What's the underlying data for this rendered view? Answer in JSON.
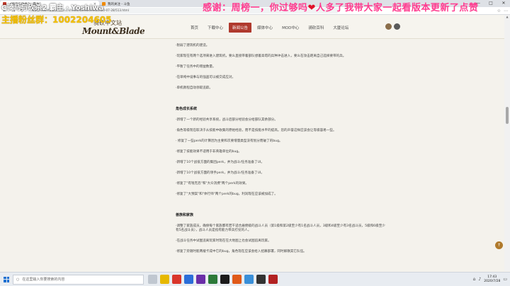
{
  "browser": {
    "tab_active_title": "《骑马与砍杀2：霸主》",
    "tab_inactive_title": "我的关注 - 斗鱼",
    "url": "www.mountblade.com.cn/news/fbnewsfeed/2020-07-28/513.html",
    "window_controls": [
      "—",
      "□",
      "✕"
    ]
  },
  "overlay": {
    "line1": "C骑马与砍杀2 霸主 · Yoshiwa",
    "line2": "主播粉丝群：1002204605",
    "banner": "感谢：周榜一，你过够吗",
    "banner_heart": "❤",
    "banner_tail": "人多了我带大家一起看版本更新了点赞"
  },
  "site": {
    "logo_cn": "骑砍中文站",
    "logo_en": "Mount&Blade",
    "nav": [
      "首页",
      "下载中心",
      "新闻公告",
      "媒体中心",
      "MOD中心",
      "骑砍百科",
      "大厦论坛"
    ],
    "nav_active_index": 2
  },
  "content": {
    "paragraphs_top": [
      "·削弱了建筑机的建造。",
      "·玩家现在有两个选项来进入建筑机，要么直接带着部队想着高塔的兵种冲击进入，要么在攻击距离自己选择要带的兵。",
      "·平衡了任务中的增益数量。",
      "·在单纯中设事与的强盗可以被交成应对。",
      "·单机教程自动领取追踪。"
    ],
    "section1_title": "角色成长系统",
    "section1": [
      "·新增了一个新的经验共享系统，战斗后部分经验会分给部队其余部分。",
      "·角色等级现在取决于从技能中收集的原始经验，而不是技能水平的提高。您的声誉这样应该会让等级容易一些。",
      "· 修复了一些perk的计算因为主要和次要增量类型没有划分而破了的bug。",
      "·修复了技能效果不适用于非英雄单位的bug。",
      "·新增了10个战役方面的集团perk，并为战斗/任务准备了UI。",
      "·新增了10个战役方面的领手perk，并为战斗/任务准备了UI。",
      "·修复了\"有钱无恐\"和\"大众消费\"两个perk的效果。",
      "·修复了\"大预案\"和\"体行师\"两个perk的bug，利润现在应该被加成了。"
    ],
    "section2_title": "兽族和家族",
    "section2": [
      "·调整了家族成员，确保每个家族都有若干适合雇佣级的战斗人员（第1级和第2级至少有1名战斗人员，3级和4级至少有3名战斗员，5级和6级至少有5名战斗员），战斗人员是指有能力带兵打仗的人。",
      "·在战斗任务中试图追离玩家时现在在大地图上也会试图追离玩家。",
      "·修复了旁随时能两棱卡成中它的bug，角色现在应该会给入招募部署，同时解散其它队伍。"
    ]
  },
  "taskbar": {
    "search_placeholder": "在这里输入你要搜索的内容",
    "time": "17:43",
    "date": "2020/7/28"
  }
}
